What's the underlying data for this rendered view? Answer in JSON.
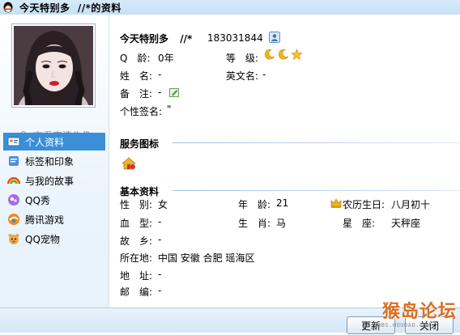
{
  "window": {
    "title_name": "今天特别多",
    "title_suffix": "  //*的资料"
  },
  "sidebar": {
    "hd_avatar_link": "查看高清头像",
    "items": [
      {
        "label": "个人资料",
        "icon": "profile-card-icon",
        "active": true
      },
      {
        "label": "标签和印象",
        "icon": "tag-icon",
        "active": false
      },
      {
        "label": "与我的故事",
        "icon": "rainbow-icon",
        "active": false
      },
      {
        "label": "QQ秀",
        "icon": "qq-show-icon",
        "active": false
      },
      {
        "label": "腾讯游戏",
        "icon": "game-icon",
        "active": false
      },
      {
        "label": "QQ宠物",
        "icon": "pet-icon",
        "active": false
      }
    ]
  },
  "profile": {
    "nickname": "今天特别多",
    "remark_sep": "//*",
    "qq_number": "183031844",
    "age_label": "Q　龄:",
    "age_value": "0年",
    "level_label": "等　级:",
    "name_label": "姓　名:",
    "name_value": "-",
    "english_name_label": "英文名:",
    "english_name_value": "-",
    "note_label": "备　注:",
    "note_value": "-",
    "signature_label": "个性签名:",
    "signature_value": "\""
  },
  "service_section": {
    "title": "服务图标"
  },
  "basic_section": {
    "title": "基本资料",
    "gender_label": "性　别:",
    "gender_value": "女",
    "age_label": "年　龄:",
    "age_value": "21",
    "lunar_birthday_label": "农历生日:",
    "lunar_birthday_value": "八月初十",
    "blood_label": "血　型:",
    "blood_value": "-",
    "zodiac_label": "生　肖:",
    "zodiac_value": "马",
    "constellation_label": "星　座:",
    "constellation_value": "天秤座",
    "hometown_label": "故　乡:",
    "hometown_value": "-",
    "location_label": "所在地:",
    "location_value": "中国 安徽 合肥 瑶海区",
    "address_label": "地　址:",
    "address_value": "-",
    "postcode_label": "邮　编:",
    "postcode_value": "-"
  },
  "buttons": {
    "refresh": "更新",
    "close": "关闭"
  },
  "watermark": {
    "main": "猴岛论坛",
    "sub": "BBS.HOUDAO.COM"
  }
}
